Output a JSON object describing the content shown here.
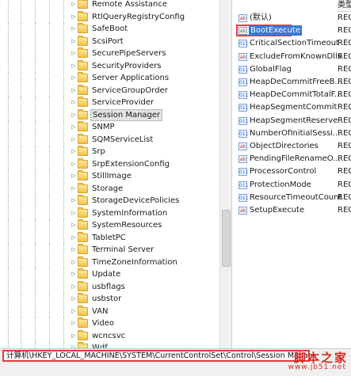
{
  "tree": {
    "items": [
      {
        "label": "Remote Assistance",
        "selected": false
      },
      {
        "label": "RtlQueryRegistryConfig",
        "selected": false
      },
      {
        "label": "SafeBoot",
        "selected": false
      },
      {
        "label": "ScsiPort",
        "selected": false
      },
      {
        "label": "SecurePipeServers",
        "selected": false
      },
      {
        "label": "SecurityProviders",
        "selected": false
      },
      {
        "label": "Server Applications",
        "selected": false
      },
      {
        "label": "ServiceGroupOrder",
        "selected": false
      },
      {
        "label": "ServiceProvider",
        "selected": false
      },
      {
        "label": "Session Manager",
        "selected": true
      },
      {
        "label": "SNMP",
        "selected": false
      },
      {
        "label": "SQMServiceList",
        "selected": false
      },
      {
        "label": "Srp",
        "selected": false
      },
      {
        "label": "SrpExtensionConfig",
        "selected": false
      },
      {
        "label": "StillImage",
        "selected": false
      },
      {
        "label": "Storage",
        "selected": false
      },
      {
        "label": "StorageDevicePolicies",
        "selected": false
      },
      {
        "label": "SystemInformation",
        "selected": false
      },
      {
        "label": "SystemResources",
        "selected": false
      },
      {
        "label": "TabletPC",
        "selected": false
      },
      {
        "label": "Terminal Server",
        "selected": false
      },
      {
        "label": "TimeZoneInformation",
        "selected": false
      },
      {
        "label": "Update",
        "selected": false
      },
      {
        "label": "usbflags",
        "selected": false
      },
      {
        "label": "usbstor",
        "selected": false
      },
      {
        "label": "VAN",
        "selected": false
      },
      {
        "label": "Video",
        "selected": false
      },
      {
        "label": "wcncsvc",
        "selected": false
      },
      {
        "label": "Wdf",
        "selected": false
      }
    ]
  },
  "values": {
    "header_type": "类型",
    "items": [
      {
        "name": "(默认)",
        "type": "REG",
        "icon": "ab",
        "highlight": false
      },
      {
        "name": "BootExecute",
        "type": "REG",
        "icon": "ab",
        "highlight": true
      },
      {
        "name": "CriticalSectionTimeout",
        "type": "REG",
        "icon": "bin",
        "highlight": false
      },
      {
        "name": "ExcludeFromKnownDlls",
        "type": "REG",
        "icon": "ab",
        "highlight": false
      },
      {
        "name": "GlobalFlag",
        "type": "REG",
        "icon": "bin",
        "highlight": false
      },
      {
        "name": "HeapDeCommitFreeB...",
        "type": "REG",
        "icon": "bin",
        "highlight": false
      },
      {
        "name": "HeapDeCommitTotalF...",
        "type": "REG",
        "icon": "bin",
        "highlight": false
      },
      {
        "name": "HeapSegmentCommit",
        "type": "REG",
        "icon": "bin",
        "highlight": false
      },
      {
        "name": "HeapSegmentReserve",
        "type": "REG",
        "icon": "bin",
        "highlight": false
      },
      {
        "name": "NumberOfInitialSessi...",
        "type": "REG",
        "icon": "bin",
        "highlight": false
      },
      {
        "name": "ObjectDirectories",
        "type": "REG",
        "icon": "ab",
        "highlight": false
      },
      {
        "name": "PendingFileRenameO...",
        "type": "REG",
        "icon": "ab",
        "highlight": false
      },
      {
        "name": "ProcessorControl",
        "type": "REG",
        "icon": "bin",
        "highlight": false
      },
      {
        "name": "ProtectionMode",
        "type": "REG",
        "icon": "bin",
        "highlight": false
      },
      {
        "name": "ResourceTimeoutCount",
        "type": "REG",
        "icon": "bin",
        "highlight": false
      },
      {
        "name": "SetupExecute",
        "type": "REG",
        "icon": "ab",
        "highlight": false
      }
    ]
  },
  "status": {
    "path": "计算机\\HKEY_LOCAL_MACHINE\\SYSTEM\\CurrentControlSet\\Control\\Session Manager"
  },
  "watermark": {
    "text": "脚本之家",
    "url": "www.jb51.net"
  },
  "colors": {
    "highlight_border": "#e23b3b",
    "selection_blue": "#3a78d6",
    "watermark_red": "#d8261f"
  }
}
